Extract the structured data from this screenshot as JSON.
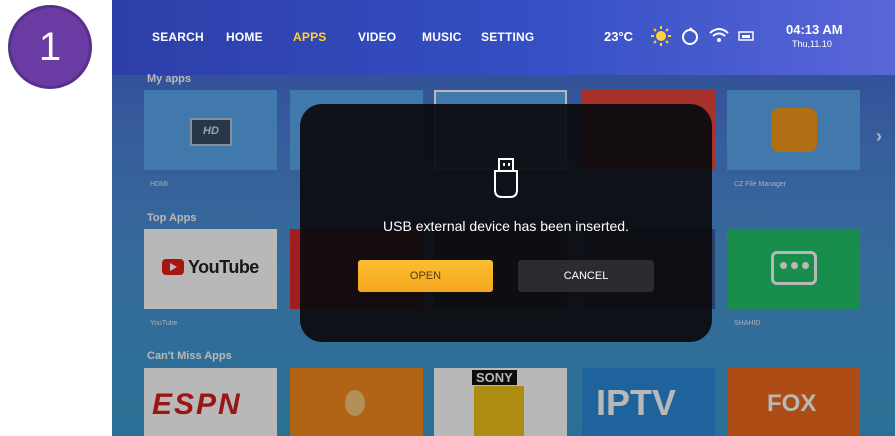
{
  "step_badge": "1",
  "nav": {
    "items": [
      "SEARCH",
      "HOME",
      "APPS",
      "VIDEO",
      "MUSIC",
      "SETTING"
    ],
    "active": "APPS"
  },
  "status": {
    "temperature": "23°C",
    "weather_icon": "sun-icon",
    "time": "04:13 AM",
    "date": "Thu,11.10"
  },
  "sections": {
    "my_apps": "My apps",
    "top_apps": "Top Apps",
    "cant_miss": "Can't Miss Apps"
  },
  "my_apps": {
    "tile1": {
      "label": "HDMI",
      "logo": "HD"
    },
    "tile5": {
      "label": "CZ File Manager"
    }
  },
  "top_apps": {
    "youtube": {
      "label": "YouTube",
      "logo": "YouTube"
    },
    "shahid": {
      "label": "SHAHID"
    }
  },
  "cant_miss": {
    "espn": "ESPN",
    "sony": "SONY",
    "iptv": "IPTV",
    "fox": "FOX"
  },
  "dialog": {
    "message": "USB external device has been inserted.",
    "open": "OPEN",
    "cancel": "CANCEL"
  },
  "colors": {
    "accent": "#ffd23a",
    "open_button": "#f6ad24",
    "badge": "#6a3ba2"
  }
}
